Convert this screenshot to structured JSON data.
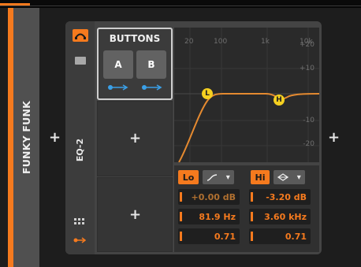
{
  "track": {
    "name": "FUNKY FUNK",
    "color": "#f57a1e"
  },
  "device": {
    "name": "EQ-2"
  },
  "buttons_panel": {
    "title": "BUTTONS",
    "button_a": "A",
    "button_b": "B"
  },
  "add_label": "+",
  "graph": {
    "freq_labels": [
      "20",
      "100",
      "1k",
      "10k"
    ],
    "gain_labels": [
      "+20",
      "+10",
      "-10",
      "-20"
    ],
    "low_marker": "L",
    "high_marker": "H"
  },
  "low_band": {
    "label": "Lo",
    "gain": "+0.00 dB",
    "freq": "81.9 Hz",
    "q": "0.71"
  },
  "high_band": {
    "label": "Hi",
    "gain": "-3.20 dB",
    "freq": "3.60 kHz",
    "q": "0.71"
  },
  "icons": [
    "power-icon",
    "folder-icon",
    "grid-icon",
    "arrow-icon",
    "chevron-down-icon"
  ],
  "colors": {
    "accent": "#f57a1e",
    "marker": "#f5d020"
  }
}
